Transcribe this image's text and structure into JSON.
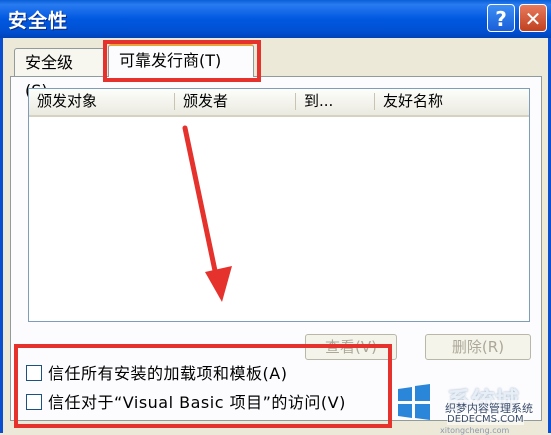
{
  "window": {
    "title": "安全性",
    "help_glyph": "?",
    "close_glyph": "✕"
  },
  "tabs": [
    {
      "label": "安全级(S)"
    },
    {
      "label": "可靠发行商(T)"
    }
  ],
  "list": {
    "columns": [
      "颁发对象",
      "颁发者",
      "到...",
      "友好名称"
    ]
  },
  "buttons": {
    "view": "查看(V)",
    "delete": "删除(R)"
  },
  "checkboxes": [
    {
      "label": "信任所有安装的加载项和模板(A)",
      "checked": false
    },
    {
      "label": "信任对于“Visual Basic 项目”的访问(V)",
      "checked": false
    }
  ],
  "watermark": {
    "brand": "系统城",
    "line1": "织梦内容管理系统",
    "line2": "DEDECMS.COM",
    "line3": "xitongcheng.com"
  },
  "colors": {
    "titlebar": "#0058e0",
    "highlight": "#e5322d",
    "dialog_bg": "#ece9d8"
  }
}
